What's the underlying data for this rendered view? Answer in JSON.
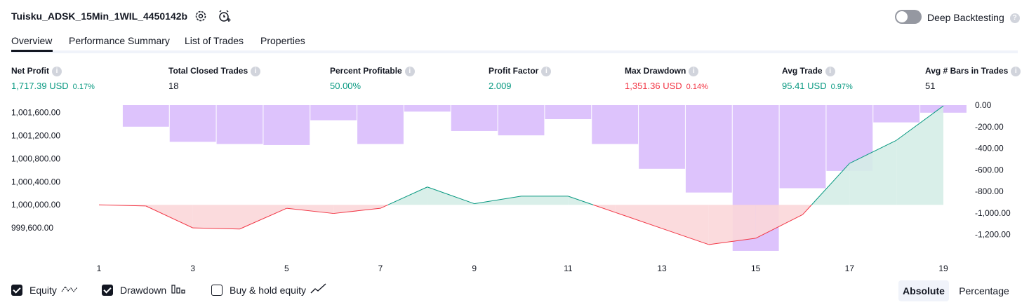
{
  "header": {
    "strategy_name": "Tuisku_ADSK_15Min_1WIL_4450142b",
    "settings_icon": "gear-icon",
    "alert_icon": "alarm-clock-add-icon",
    "deep_backtesting_label": "Deep Backtesting",
    "deep_backtesting_enabled": false
  },
  "tabs": [
    {
      "label": "Overview",
      "active": true
    },
    {
      "label": "Performance Summary",
      "active": false
    },
    {
      "label": "List of Trades",
      "active": false
    },
    {
      "label": "Properties",
      "active": false
    }
  ],
  "metrics": [
    {
      "label": "Net Profit",
      "value": "1,717.39 USD",
      "sub": "0.17%",
      "color": "#089981"
    },
    {
      "label": "Total Closed Trades",
      "value": "18",
      "sub": "",
      "color": "#131722"
    },
    {
      "label": "Percent Profitable",
      "value": "50.00%",
      "sub": "",
      "color": "#089981"
    },
    {
      "label": "Profit Factor",
      "value": "2.009",
      "sub": "",
      "color": "#089981"
    },
    {
      "label": "Max Drawdown",
      "value": "1,351.36 USD",
      "sub": "0.14%",
      "color": "#f23645"
    },
    {
      "label": "Avg Trade",
      "value": "95.41 USD",
      "sub": "0.97%",
      "color": "#089981"
    },
    {
      "label": "Avg # Bars in Trades",
      "value": "51",
      "sub": "",
      "color": "#131722"
    }
  ],
  "chart_data": {
    "type": "line",
    "x": [
      1,
      2,
      3,
      4,
      5,
      6,
      7,
      8,
      9,
      10,
      11,
      12,
      13,
      14,
      15,
      16,
      17,
      18,
      19
    ],
    "x_tick_labels": [
      "1",
      "3",
      "5",
      "7",
      "9",
      "11",
      "13",
      "15",
      "17",
      "19"
    ],
    "series": [
      {
        "name": "Equity",
        "axis": "left",
        "values": [
          1000000,
          999980,
          999600,
          999580,
          999940,
          999850,
          999940,
          1000310,
          1000020,
          1000150,
          1000150,
          999870,
          999590,
          999310,
          999420,
          999830,
          1000720,
          1001120,
          1001717
        ]
      },
      {
        "name": "Drawdown",
        "axis": "right",
        "type": "bar",
        "values": [
          0,
          -200,
          -340,
          -360,
          -370,
          -140,
          -360,
          -60,
          -240,
          -280,
          -130,
          -360,
          -590,
          -810,
          -1351,
          -770,
          -610,
          -160,
          -70
        ]
      }
    ],
    "y_left_ticks": [
      "1,001,600.00",
      "1,001,200.00",
      "1,000,800.00",
      "1,000,400.00",
      "1,000,000.00",
      "999,600.00"
    ],
    "y_left_range": [
      999200,
      1001730
    ],
    "y_right_ticks": [
      "0.00",
      "-200.00",
      "-400.00",
      "-600.00",
      "-800.00",
      "-1,000.00",
      "-1,200.00"
    ],
    "y_right_range": [
      -1351.36,
      0
    ],
    "colors": {
      "equity_up": "#089981",
      "equity_down": "#f23645",
      "drawdown_bar": "#d7b8fb",
      "fill_up": "#d5ede7",
      "fill_down": "#fbd7d9"
    }
  },
  "legend": [
    {
      "label": "Equity",
      "checked": true,
      "icon": "equity-line-icon"
    },
    {
      "label": "Drawdown",
      "checked": true,
      "icon": "bar-chart-icon"
    },
    {
      "label": "Buy & hold equity",
      "checked": false,
      "icon": "trend-line-icon"
    }
  ],
  "view_mode": {
    "absolute_label": "Absolute",
    "percentage_label": "Percentage",
    "active": "Absolute"
  }
}
